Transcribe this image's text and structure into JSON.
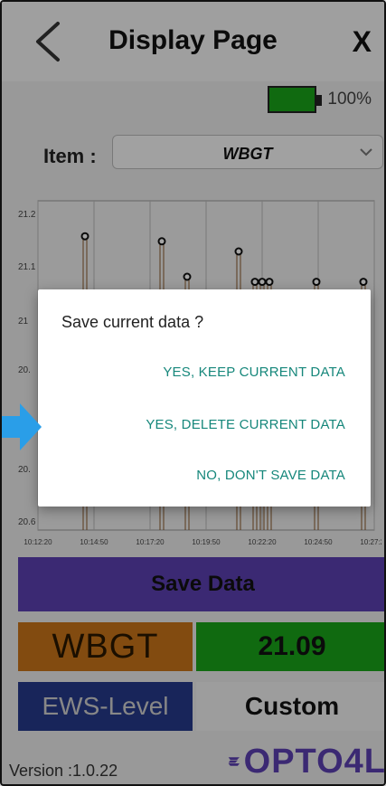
{
  "header": {
    "title": "Display Page",
    "close_label": "X"
  },
  "battery": {
    "percent_label": "100%",
    "level": 1.0,
    "color": "#1aa31a"
  },
  "item": {
    "label": "Item :",
    "selected": "WBGT"
  },
  "chart_data": {
    "type": "line",
    "y_ticks": [
      "21.2",
      "21.1",
      "21",
      "20.",
      "20.",
      "20.6"
    ],
    "x_ticks": [
      "10:12:20",
      "10:14:50",
      "10:17:20",
      "10:19:50",
      "10:22:20",
      "10:24:50",
      "10:27:20"
    ],
    "ylim": [
      20.6,
      21.25
    ],
    "series": [
      {
        "values": [
          21.18,
          21.17,
          21.1,
          21.15,
          21.09,
          21.09,
          21.09,
          21.09,
          21.09
        ]
      }
    ]
  },
  "dialog": {
    "message": "Save current data ?",
    "option_keep": "YES, KEEP CURRENT DATA",
    "option_delete": "YES, DELETE CURRENT DATA",
    "option_no": "NO, DON'T SAVE DATA",
    "accent_color": "#16877b"
  },
  "actions": {
    "save_label": "Save Data"
  },
  "readings": {
    "wbgt_label": "WBGT",
    "wbgt_value": "21.09",
    "ews_label": "EWS-Level",
    "ews_value": "Custom"
  },
  "footer": {
    "version": "Version :1.0.22",
    "logo_text": "OPTO4L"
  }
}
